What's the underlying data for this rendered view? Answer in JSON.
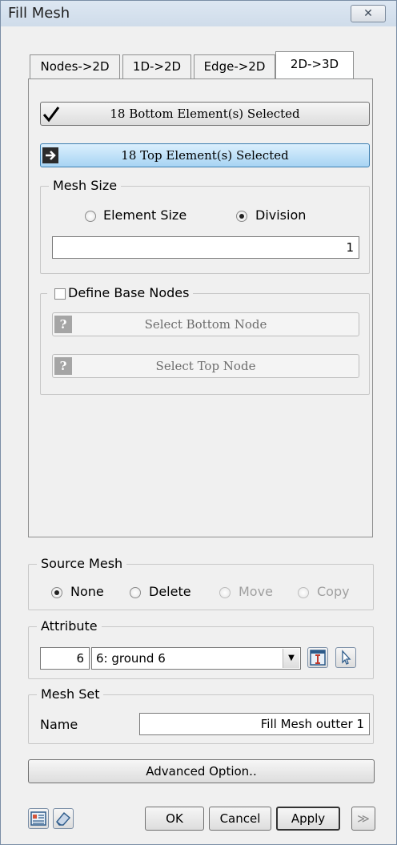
{
  "window": {
    "title": "Fill Mesh",
    "close_glyph": "✕"
  },
  "tabs": [
    {
      "label": "Nodes->2D",
      "active": false
    },
    {
      "label": "1D->2D",
      "active": false
    },
    {
      "label": "Edge->2D",
      "active": false
    },
    {
      "label": "2D->3D",
      "active": true
    }
  ],
  "selection": {
    "bottom_label": "18 Bottom Element(s) Selected",
    "bottom_icon": "checkmark-icon",
    "top_label": "18 Top Element(s) Selected",
    "top_icon": "arrow-right-icon"
  },
  "mesh_size": {
    "group_label": "Mesh Size",
    "options": [
      {
        "label": "Element Size",
        "checked": false
      },
      {
        "label": "Division",
        "checked": true
      }
    ],
    "value": "1"
  },
  "base_nodes": {
    "label": "Define Base Nodes",
    "checked": false,
    "bottom_button": "Select Bottom Node",
    "top_button": "Select Top Node",
    "button_icon": "question-mark-icon",
    "icon_glyph": "?"
  },
  "source_mesh": {
    "group_label": "Source Mesh",
    "options": [
      {
        "label": "None",
        "checked": true,
        "enabled": true
      },
      {
        "label": "Delete",
        "checked": false,
        "enabled": true
      },
      {
        "label": "Move",
        "checked": false,
        "enabled": false
      },
      {
        "label": "Copy",
        "checked": false,
        "enabled": false
      }
    ]
  },
  "attribute": {
    "group_label": "Attribute",
    "id": "6",
    "selected": "6: ground 6",
    "dropdown_glyph": "▼"
  },
  "mesh_set": {
    "group_label": "Mesh Set",
    "name_label": "Name",
    "name_value": "Fill Mesh outter 1"
  },
  "advanced_label": "Advanced Option..",
  "footer": {
    "ok": "OK",
    "cancel": "Cancel",
    "apply": "Apply",
    "more_glyph": "≫"
  },
  "colors": {
    "window_bg": "#f0f0f0",
    "top_button_accent": "#a7d4f3",
    "disabled_text": "#a0a0a0"
  }
}
